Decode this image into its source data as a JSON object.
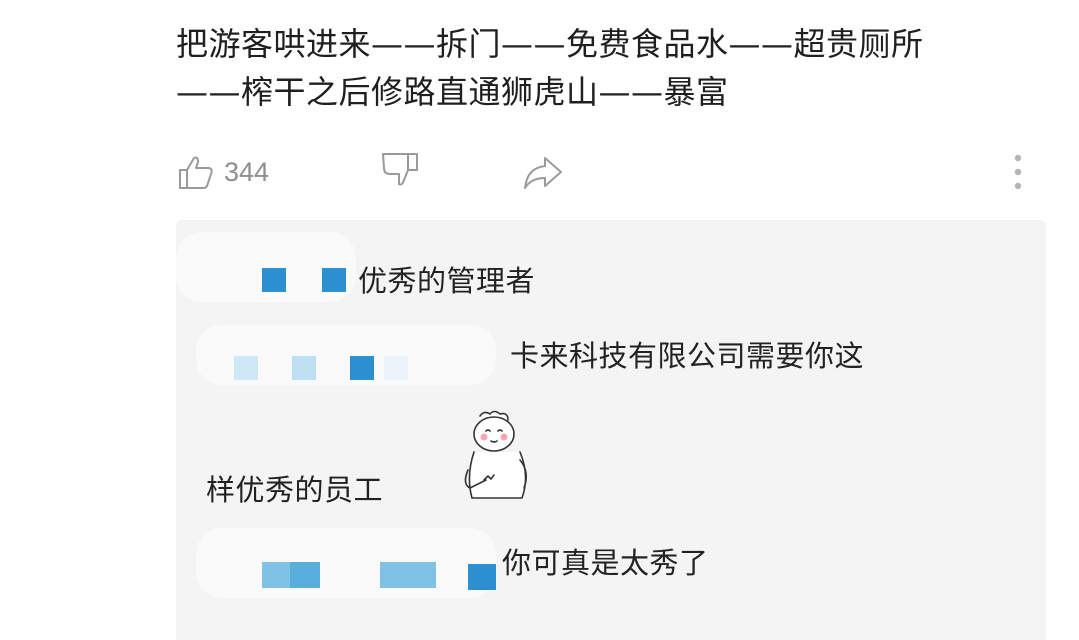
{
  "post": {
    "line1": "把游客哄进来——拆门——免费食品水——超贵厕所",
    "line2": "——榨干之后修路直通狮虎山——暴富"
  },
  "actions": {
    "like_count": "344",
    "icons": [
      "thumbs-up-icon",
      "thumbs-down-icon",
      "share-icon",
      "more-vertical-icon"
    ]
  },
  "replies": [
    {
      "text": "优秀的管理者"
    },
    {
      "text": "卡来科技有限公司需要你这"
    },
    {
      "text": "样优秀的员工"
    },
    {
      "text": "你可真是太秀了"
    }
  ],
  "colors": {
    "accent_blue": "#2b8fd0",
    "light_blue": "#7ec3e6",
    "pale_blue": "#cfe8f5",
    "reply_bg": "#f4f4f4",
    "icon_gray": "#9a9a9a"
  }
}
